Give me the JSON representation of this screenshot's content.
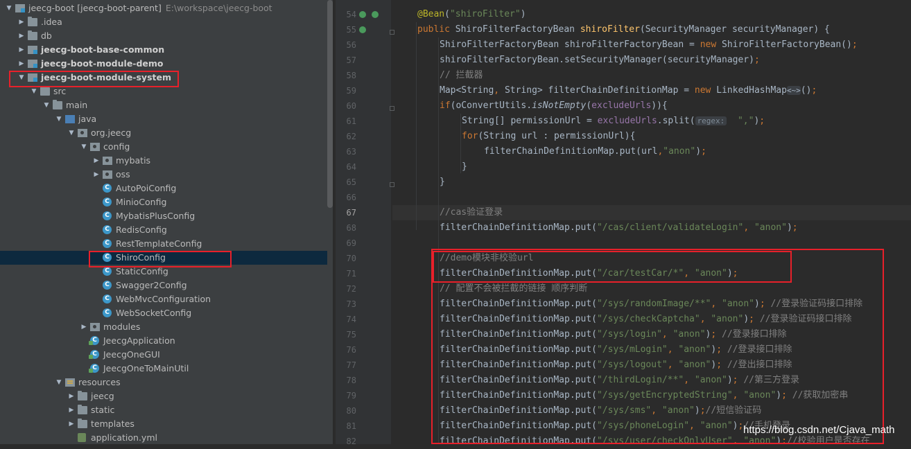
{
  "project_tree": {
    "rows": [
      {
        "label": "jeecg-boot [jeecg-boot-parent]",
        "path": "E:\\workspace\\jeecg-boot",
        "icon": "module-folder-icon",
        "expanded": true
      },
      {
        "label": ".idea",
        "icon": "folder-icon",
        "expanded": false
      },
      {
        "label": "db",
        "icon": "folder-icon",
        "expanded": false
      },
      {
        "label": "jeecg-boot-base-common",
        "icon": "module-folder-icon",
        "expanded": false
      },
      {
        "label": "jeecg-boot-module-demo",
        "icon": "module-folder-icon",
        "expanded": false
      },
      {
        "label": "jeecg-boot-module-system",
        "icon": "module-folder-icon",
        "expanded": true
      },
      {
        "label": "src",
        "icon": "folder-icon",
        "expanded": true
      },
      {
        "label": "main",
        "icon": "folder-icon",
        "expanded": true
      },
      {
        "label": "java",
        "icon": "source-folder-icon",
        "expanded": true
      },
      {
        "label": "org.jeecg",
        "icon": "package-icon",
        "expanded": true
      },
      {
        "label": "config",
        "icon": "package-icon",
        "expanded": true
      },
      {
        "label": "mybatis",
        "icon": "package-icon",
        "expanded": false
      },
      {
        "label": "oss",
        "icon": "package-icon",
        "expanded": false
      },
      {
        "label": "AutoPoiConfig",
        "icon": "class-icon"
      },
      {
        "label": "MinioConfig",
        "icon": "class-icon"
      },
      {
        "label": "MybatisPlusConfig",
        "icon": "class-icon"
      },
      {
        "label": "RedisConfig",
        "icon": "class-icon"
      },
      {
        "label": "RestTemplateConfig",
        "icon": "class-icon"
      },
      {
        "label": "ShiroConfig",
        "icon": "class-icon",
        "selected": true
      },
      {
        "label": "StaticConfig",
        "icon": "class-icon"
      },
      {
        "label": "Swagger2Config",
        "icon": "class-icon"
      },
      {
        "label": "WebMvcConfiguration",
        "icon": "class-icon"
      },
      {
        "label": "WebSocketConfig",
        "icon": "class-icon"
      },
      {
        "label": "modules",
        "icon": "package-icon",
        "expanded": false
      },
      {
        "label": "JeecgApplication",
        "icon": "application-class-icon"
      },
      {
        "label": "JeecgOneGUI",
        "icon": "application-class-icon"
      },
      {
        "label": "JeecgOneToMainUtil",
        "icon": "application-class-icon"
      },
      {
        "label": "resources",
        "icon": "resources-folder-icon",
        "expanded": true
      },
      {
        "label": "jeecg",
        "icon": "folder-icon",
        "expanded": false
      },
      {
        "label": "static",
        "icon": "folder-icon",
        "expanded": false
      },
      {
        "label": "templates",
        "icon": "folder-icon",
        "expanded": false
      },
      {
        "label": "application.yml",
        "icon": "yaml-file-icon"
      }
    ]
  },
  "editor": {
    "current_line": 67,
    "lines": [
      {
        "n": "54",
        "seg": [
          [
            "an",
            "@Bean"
          ],
          [
            "",
            "("
          ],
          [
            "st",
            "\"shiroFilter\""
          ],
          [
            "",
            ")"
          ]
        ]
      },
      {
        "n": "55",
        "seg": [
          [
            "kw",
            "public "
          ],
          [
            "",
            "ShiroFilterFactoryBean "
          ],
          [
            "fn",
            "shiroFilter"
          ],
          [
            "",
            "(SecurityManager securityManager) {"
          ]
        ]
      },
      {
        "n": "56",
        "seg": [
          [
            "",
            "ShiroFilterFactoryBean shiroFilterFactoryBean = "
          ],
          [
            "kw",
            "new "
          ],
          [
            "",
            "ShiroFilterFactoryBean()"
          ],
          [
            "kw",
            ";"
          ]
        ]
      },
      {
        "n": "57",
        "seg": [
          [
            "",
            "shiroFilterFactoryBean.setSecurityManager(securityManager)"
          ],
          [
            "kw",
            ";"
          ]
        ]
      },
      {
        "n": "58",
        "seg": [
          [
            "cm",
            "// 拦截器"
          ]
        ]
      },
      {
        "n": "59",
        "seg": [
          [
            "",
            "Map<String"
          ],
          [
            "kw",
            ", "
          ],
          [
            "",
            "String> filterChainDefinitionMap = "
          ],
          [
            "kw",
            "new "
          ],
          [
            "",
            "LinkedHashMap"
          ],
          [
            "diam",
            "<~>"
          ],
          [
            "",
            "()"
          ],
          [
            "kw",
            ";"
          ]
        ]
      },
      {
        "n": "60",
        "seg": [
          [
            "kw",
            "if"
          ],
          [
            "",
            "(oConvertUtils."
          ],
          [
            "it",
            "isNotEmpty"
          ],
          [
            "",
            "("
          ],
          [
            "fl",
            "excludeUrls"
          ],
          [
            "",
            ")){"
          ]
        ]
      },
      {
        "n": "61",
        "seg": [
          [
            "",
            "String[] permissionUrl = "
          ],
          [
            "fl",
            "excludeUrls"
          ],
          [
            "",
            ".split("
          ],
          [
            "hint",
            "regex:"
          ],
          [
            "",
            "  "
          ],
          [
            "st",
            "\",\""
          ],
          [
            "",
            ")"
          ],
          [
            "kw",
            ";"
          ]
        ]
      },
      {
        "n": "62",
        "seg": [
          [
            "kw",
            "for"
          ],
          [
            "",
            "(String url : permissionUrl){"
          ]
        ]
      },
      {
        "n": "63",
        "seg": [
          [
            "",
            "filterChainDefinitionMap.put(url"
          ],
          [
            "kw",
            ","
          ],
          [
            "st",
            "\"anon\""
          ],
          [
            "",
            ")"
          ],
          [
            "kw",
            ";"
          ]
        ]
      },
      {
        "n": "64",
        "seg": [
          [
            "",
            "}"
          ]
        ]
      },
      {
        "n": "65",
        "seg": [
          [
            "",
            "}"
          ]
        ]
      },
      {
        "n": "66",
        "seg": []
      },
      {
        "n": "67",
        "seg": [
          [
            "cm",
            "//cas验证登录"
          ]
        ]
      },
      {
        "n": "68",
        "seg": [
          [
            "",
            "filterChainDefinitionMap.put("
          ],
          [
            "st",
            "\"/cas/client/validateLogin\""
          ],
          [
            "kw",
            ", "
          ],
          [
            "st",
            "\"anon\""
          ],
          [
            "",
            ")"
          ],
          [
            "kw",
            ";"
          ]
        ]
      },
      {
        "n": "69",
        "seg": []
      },
      {
        "n": "70",
        "seg": [
          [
            "cm",
            "//demo模块非校验url"
          ]
        ]
      },
      {
        "n": "71",
        "seg": [
          [
            "",
            "filterChainDefinitionMap.put("
          ],
          [
            "st",
            "\"/car/testCar/*\""
          ],
          [
            "kw",
            ", "
          ],
          [
            "st",
            "\"anon\""
          ],
          [
            "",
            ")"
          ],
          [
            "kw",
            ";"
          ]
        ]
      },
      {
        "n": "72",
        "seg": [
          [
            "cm",
            "// 配置不会被拦截的链接 顺序判断"
          ]
        ]
      },
      {
        "n": "73",
        "seg": [
          [
            "",
            "filterChainDefinitionMap.put("
          ],
          [
            "st",
            "\"/sys/randomImage/**\""
          ],
          [
            "kw",
            ", "
          ],
          [
            "st",
            "\"anon\""
          ],
          [
            "",
            ")"
          ],
          [
            "kw",
            "; "
          ],
          [
            "cm",
            "//登录验证码接口排除"
          ]
        ]
      },
      {
        "n": "74",
        "seg": [
          [
            "",
            "filterChainDefinitionMap.put("
          ],
          [
            "st",
            "\"/sys/checkCaptcha\""
          ],
          [
            "kw",
            ", "
          ],
          [
            "st",
            "\"anon\""
          ],
          [
            "",
            ")"
          ],
          [
            "kw",
            "; "
          ],
          [
            "cm",
            "//登录验证码接口排除"
          ]
        ]
      },
      {
        "n": "75",
        "seg": [
          [
            "",
            "filterChainDefinitionMap.put("
          ],
          [
            "st",
            "\"/sys/login\""
          ],
          [
            "kw",
            ", "
          ],
          [
            "st",
            "\"anon\""
          ],
          [
            "",
            ")"
          ],
          [
            "kw",
            "; "
          ],
          [
            "cm",
            "//登录接口排除"
          ]
        ]
      },
      {
        "n": "76",
        "seg": [
          [
            "",
            "filterChainDefinitionMap.put("
          ],
          [
            "st",
            "\"/sys/mLogin\""
          ],
          [
            "kw",
            ", "
          ],
          [
            "st",
            "\"anon\""
          ],
          [
            "",
            ")"
          ],
          [
            "kw",
            "; "
          ],
          [
            "cm",
            "//登录接口排除"
          ]
        ]
      },
      {
        "n": "77",
        "seg": [
          [
            "",
            "filterChainDefinitionMap.put("
          ],
          [
            "st",
            "\"/sys/logout\""
          ],
          [
            "kw",
            ", "
          ],
          [
            "st",
            "\"anon\""
          ],
          [
            "",
            ")"
          ],
          [
            "kw",
            "; "
          ],
          [
            "cm",
            "//登出接口排除"
          ]
        ]
      },
      {
        "n": "78",
        "seg": [
          [
            "",
            "filterChainDefinitionMap.put("
          ],
          [
            "st",
            "\"/thirdLogin/**\""
          ],
          [
            "kw",
            ", "
          ],
          [
            "st",
            "\"anon\""
          ],
          [
            "",
            ")"
          ],
          [
            "kw",
            "; "
          ],
          [
            "cm",
            "//第三方登录"
          ]
        ]
      },
      {
        "n": "79",
        "seg": [
          [
            "",
            "filterChainDefinitionMap.put("
          ],
          [
            "st",
            "\"/sys/getEncryptedString\""
          ],
          [
            "kw",
            ", "
          ],
          [
            "st",
            "\"anon\""
          ],
          [
            "",
            ")"
          ],
          [
            "kw",
            "; "
          ],
          [
            "cm",
            "//获取加密串"
          ]
        ]
      },
      {
        "n": "80",
        "seg": [
          [
            "",
            "filterChainDefinitionMap.put("
          ],
          [
            "st",
            "\"/sys/sms\""
          ],
          [
            "kw",
            ", "
          ],
          [
            "st",
            "\"anon\""
          ],
          [
            "",
            ")"
          ],
          [
            "kw",
            ";"
          ],
          [
            "cm",
            "//短信验证码"
          ]
        ]
      },
      {
        "n": "81",
        "seg": [
          [
            "",
            "filterChainDefinitionMap.put("
          ],
          [
            "st",
            "\"/sys/phoneLogin\""
          ],
          [
            "kw",
            ", "
          ],
          [
            "st",
            "\"anon\""
          ],
          [
            "",
            ")"
          ],
          [
            "kw",
            ";"
          ],
          [
            "cm",
            "//手机登录"
          ]
        ]
      },
      {
        "n": "82",
        "seg": [
          [
            "",
            "filterChainDefinitionMap.put("
          ],
          [
            "st",
            "\"/sys/user/checkOnlyUser\""
          ],
          [
            "kw",
            ", "
          ],
          [
            "st",
            "\"anon\""
          ],
          [
            "",
            ")"
          ],
          [
            "kw",
            ";"
          ],
          [
            "cm",
            "//校验用户是否存在"
          ]
        ]
      }
    ]
  },
  "watermark": "https://blog.csdn.net/Cjava_math",
  "colors": {
    "highlight_box": "#e8202a",
    "selection": "#0d293e",
    "keyword": "#cc7832",
    "string": "#6a8759",
    "comment": "#808080"
  }
}
